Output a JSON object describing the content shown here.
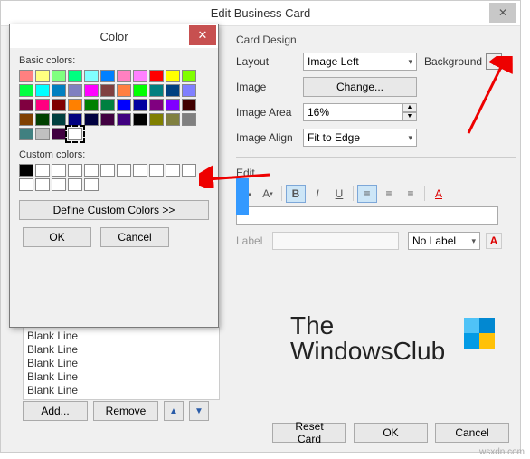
{
  "main": {
    "title": "Edit Business Card",
    "card_design_label": "Card Design",
    "layout_label": "Layout",
    "layout_value": "Image Left",
    "background_label": "Background",
    "image_label": "Image",
    "change_btn": "Change...",
    "image_area_label": "Image Area",
    "image_area_value": "16%",
    "image_align_label": "Image Align",
    "image_align_value": "Fit to Edge",
    "edit_label": "Edit",
    "label_label": "Label",
    "nolabel_value": "No Label",
    "reset_btn": "Reset Card",
    "ok_btn": "OK",
    "cancel_btn": "Cancel"
  },
  "fields": {
    "items": [
      "Blank Line",
      "Blank Line",
      "Blank Line",
      "Blank Line",
      "Blank Line"
    ],
    "add_btn": "Add...",
    "remove_btn": "Remove"
  },
  "color": {
    "title": "Color",
    "basic_label": "Basic colors:",
    "custom_label": "Custom colors:",
    "define_btn": "Define Custom Colors >>",
    "ok_btn": "OK",
    "cancel_btn": "Cancel",
    "basic_colors": [
      "#ff8080",
      "#ffff80",
      "#80ff80",
      "#00ff80",
      "#80ffff",
      "#0080ff",
      "#ff80c0",
      "#ff80ff",
      "#ff0000",
      "#ffff00",
      "#80ff00",
      "#00ff40",
      "#00ffff",
      "#0080c0",
      "#8080c0",
      "#ff00ff",
      "#804040",
      "#ff8040",
      "#00ff00",
      "#008080",
      "#004080",
      "#8080ff",
      "#800040",
      "#ff0080",
      "#800000",
      "#ff8000",
      "#008000",
      "#008040",
      "#0000ff",
      "#0000a0",
      "#800080",
      "#8000ff",
      "#400000",
      "#804000",
      "#004000",
      "#004040",
      "#000080",
      "#000040",
      "#400040",
      "#400080",
      "#000000",
      "#808000",
      "#808040",
      "#808080",
      "#408080",
      "#c0c0c0",
      "#400040",
      "#ffffff"
    ],
    "selected_index": 47
  },
  "logo": {
    "line1": "The",
    "line2": "WindowsClub"
  },
  "watermark": "wsxdn.com"
}
